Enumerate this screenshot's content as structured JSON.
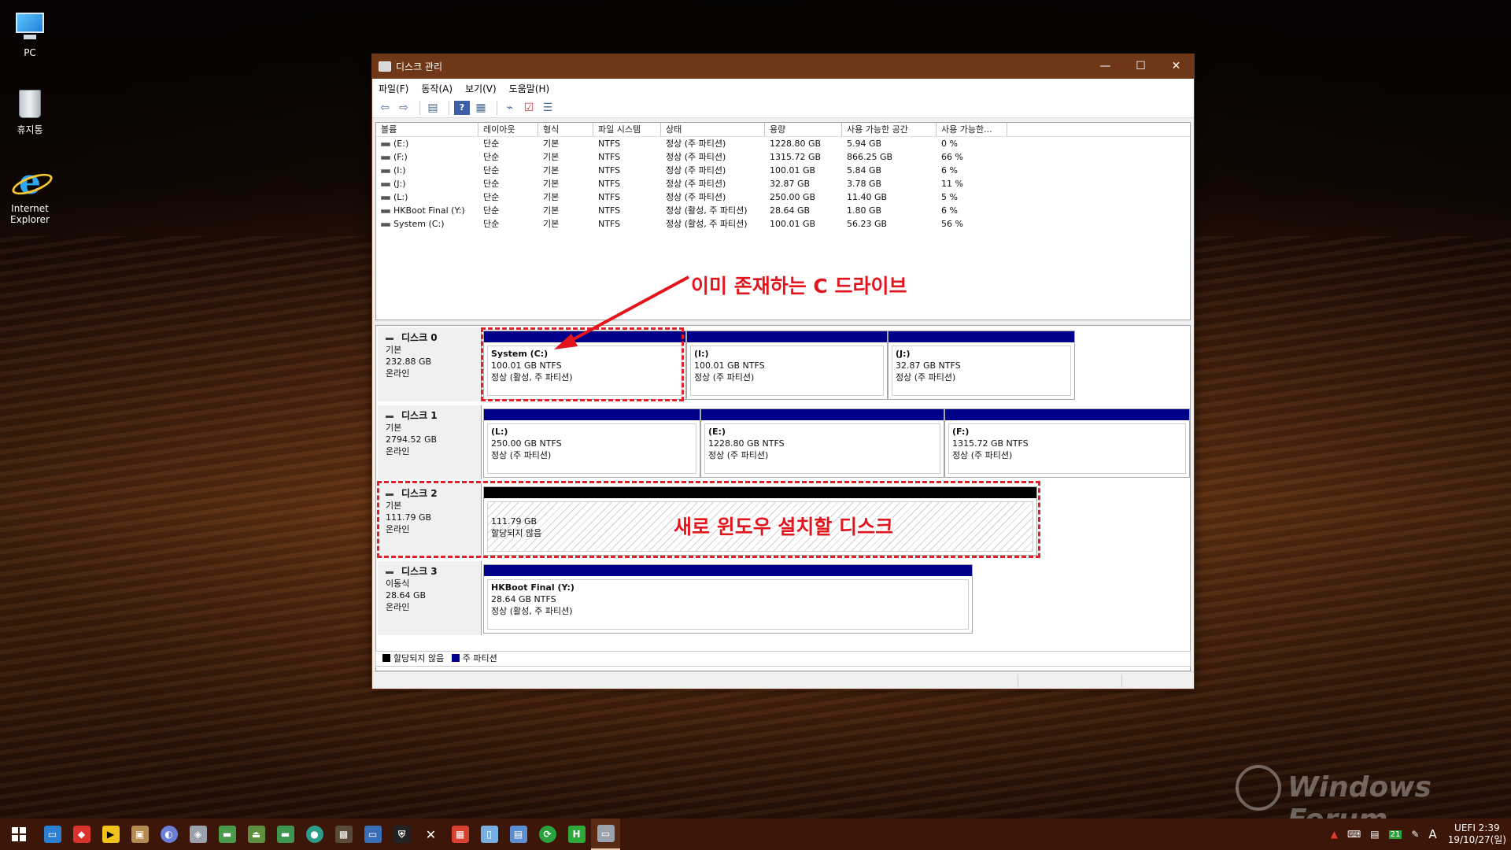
{
  "desktop": {
    "icons": [
      {
        "label": "PC"
      },
      {
        "label": "휴지통"
      },
      {
        "label_line1": "Internet",
        "label_line2": "Explorer"
      }
    ]
  },
  "window": {
    "title": "디스크 관리",
    "controls": {
      "minimize": "—",
      "maximize": "☐",
      "close": "✕"
    },
    "menu": [
      "파일(F)",
      "동작(A)",
      "보기(V)",
      "도움말(H)"
    ],
    "toolbar_icons": [
      "back-arrow-icon",
      "forward-arrow-icon",
      "console-tree-icon",
      "help-icon",
      "properties-icon",
      "connect-icon",
      "check-icon",
      "list-icon"
    ]
  },
  "volume_list": {
    "columns": [
      "볼륨",
      "레이아웃",
      "형식",
      "파일 시스템",
      "상태",
      "용량",
      "사용 가능한 공간",
      "사용 가능한..."
    ],
    "rows": [
      [
        "(E:)",
        "단순",
        "기본",
        "NTFS",
        "정상 (주 파티션)",
        "1228.80 GB",
        "5.94 GB",
        "0 %"
      ],
      [
        "(F:)",
        "단순",
        "기본",
        "NTFS",
        "정상 (주 파티션)",
        "1315.72 GB",
        "866.25 GB",
        "66 %"
      ],
      [
        "(I:)",
        "단순",
        "기본",
        "NTFS",
        "정상 (주 파티션)",
        "100.01 GB",
        "5.84 GB",
        "6 %"
      ],
      [
        "(J:)",
        "단순",
        "기본",
        "NTFS",
        "정상 (주 파티션)",
        "32.87 GB",
        "3.78 GB",
        "11 %"
      ],
      [
        "(L:)",
        "단순",
        "기본",
        "NTFS",
        "정상 (주 파티션)",
        "250.00 GB",
        "11.40 GB",
        "5 %"
      ],
      [
        "HKBoot Final (Y:)",
        "단순",
        "기본",
        "NTFS",
        "정상 (활성, 주 파티션)",
        "28.64 GB",
        "1.80 GB",
        "6 %"
      ],
      [
        "System (C:)",
        "단순",
        "기본",
        "NTFS",
        "정상 (활성, 주 파티션)",
        "100.01 GB",
        "56.23 GB",
        "56 %"
      ]
    ]
  },
  "disks": [
    {
      "name": "디스크 0",
      "type": "기본",
      "size": "232.88 GB",
      "status": "온라인",
      "partitions": [
        {
          "name": "System  (C:)",
          "size": "100.01 GB NTFS",
          "status": "정상 (활성, 주 파티션)"
        },
        {
          "name": "(I:)",
          "size": "100.01 GB NTFS",
          "status": "정상 (주 파티션)"
        },
        {
          "name": "(J:)",
          "size": "32.87 GB NTFS",
          "status": "정상 (주 파티션)"
        }
      ]
    },
    {
      "name": "디스크 1",
      "type": "기본",
      "size": "2794.52 GB",
      "status": "온라인",
      "partitions": [
        {
          "name": "(L:)",
          "size": "250.00 GB NTFS",
          "status": "정상 (주 파티션)"
        },
        {
          "name": "(E:)",
          "size": "1228.80 GB NTFS",
          "status": "정상 (주 파티션)"
        },
        {
          "name": "(F:)",
          "size": "1315.72 GB NTFS",
          "status": "정상 (주 파티션)"
        }
      ]
    },
    {
      "name": "디스크 2",
      "type": "기본",
      "size": "111.79 GB",
      "status": "온라인",
      "partitions": [
        {
          "name": "",
          "size": "111.79 GB",
          "status": "할당되지 않음"
        }
      ]
    },
    {
      "name": "디스크 3",
      "type": "이동식",
      "size": "28.64 GB",
      "status": "온라인",
      "partitions": [
        {
          "name": "HKBoot Final  (Y:)",
          "size": "28.64 GB NTFS",
          "status": "정상 (활성, 주 파티션)"
        }
      ]
    }
  ],
  "legend": {
    "unallocated": "할당되지 않음",
    "primary": "주 파티션"
  },
  "annotations": {
    "existing_c_drive": "이미 존재하는 C 드라이브",
    "new_windows_disk": "새로 윈도우 설치할 디스크"
  },
  "watermark": {
    "text": "Windows Forum"
  },
  "taskbar": {
    "tray": {
      "ime": "A",
      "badge": "21",
      "clock_top": "UEFI  2:39",
      "clock_bottom": "19/10/27(일)"
    }
  },
  "colors": {
    "titlebar": "#6e3717",
    "primary_partition": "#00008a",
    "unallocated": "#000000",
    "annotation": "#e3141c",
    "taskbar": "#3c1608"
  }
}
